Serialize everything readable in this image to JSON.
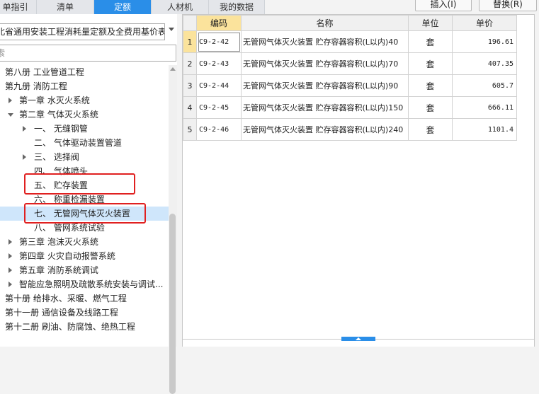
{
  "tabs": [
    {
      "label": "单指引",
      "active": false
    },
    {
      "label": "清单",
      "active": false
    },
    {
      "label": "定额",
      "active": true
    },
    {
      "label": "人材机",
      "active": false
    },
    {
      "label": "我的数据",
      "active": false
    }
  ],
  "actions": {
    "insert": "插入(I)",
    "replace": "替换(R)"
  },
  "library_select": {
    "value": "北省通用安装工程消耗量定额及全费用基价表"
  },
  "search": {
    "placeholder": "索"
  },
  "tree": [
    {
      "label": "第八册 工业管道工程",
      "level": 0,
      "expander": "none",
      "selected": false
    },
    {
      "label": "第九册 消防工程",
      "level": 0,
      "expander": "none",
      "selected": false
    },
    {
      "label": "第一章 水灭火系统",
      "level": 1,
      "expander": "collapsed",
      "selected": false
    },
    {
      "label": "第二章 气体灭火系统",
      "level": 1,
      "expander": "expanded",
      "selected": false
    },
    {
      "label": "一、 无缝钢管",
      "level": 2,
      "expander": "collapsed",
      "selected": false
    },
    {
      "label": "二、 气体驱动装置管道",
      "level": 2,
      "expander": "none",
      "selected": false
    },
    {
      "label": "三、 选择阀",
      "level": 2,
      "expander": "collapsed",
      "selected": false
    },
    {
      "label": "四、 气体喷头",
      "level": 2,
      "expander": "none",
      "selected": false
    },
    {
      "label": "五、 贮存装置",
      "level": 2,
      "expander": "none",
      "selected": false
    },
    {
      "label": "六、 称重检漏装置",
      "level": 2,
      "expander": "none",
      "selected": false
    },
    {
      "label": "七、 无管网气体灭火装置",
      "level": 2,
      "expander": "none",
      "selected": true
    },
    {
      "label": "八、 管网系统试验",
      "level": 2,
      "expander": "none",
      "selected": false
    },
    {
      "label": "第三章 泡沫灭火系统",
      "level": 1,
      "expander": "collapsed",
      "selected": false
    },
    {
      "label": "第四章 火灾自动报警系统",
      "level": 1,
      "expander": "collapsed",
      "selected": false
    },
    {
      "label": "第五章 消防系统调试",
      "level": 1,
      "expander": "collapsed",
      "selected": false
    },
    {
      "label": "智能应急照明及疏散系统安装与调试...",
      "level": 1,
      "expander": "collapsed",
      "selected": false
    },
    {
      "label": "第十册 给排水、采暖、燃气工程",
      "level": 0,
      "expander": "none",
      "selected": false
    },
    {
      "label": "第十一册 通信设备及线路工程",
      "level": 0,
      "expander": "none",
      "selected": false
    },
    {
      "label": "第十二册 刷油、防腐蚀、绝热工程",
      "level": 0,
      "expander": "none",
      "selected": false
    }
  ],
  "grid": {
    "columns": [
      "编码",
      "名称",
      "单位",
      "单价"
    ],
    "rows": [
      {
        "idx": "1",
        "code": "C9-2-42",
        "name": "无管网气体灭火装置 贮存容器容积(L以内)40",
        "unit": "套",
        "price": "196.61"
      },
      {
        "idx": "2",
        "code": "C9-2-43",
        "name": "无管网气体灭火装置 贮存容器容积(L以内)70",
        "unit": "套",
        "price": "407.35"
      },
      {
        "idx": "3",
        "code": "C9-2-44",
        "name": "无管网气体灭火装置 贮存容器容积(L以内)90",
        "unit": "套",
        "price": "605.7"
      },
      {
        "idx": "4",
        "code": "C9-2-45",
        "name": "无管网气体灭火装置 贮存容器容积(L以内)150",
        "unit": "套",
        "price": "666.11"
      },
      {
        "idx": "5",
        "code": "C9-2-46",
        "name": "无管网气体灭火装置 贮存容器容积(L以内)240",
        "unit": "套",
        "price": "1101.4"
      }
    ]
  },
  "colors": {
    "accent": "#2a8ee8",
    "highlight_box": "#e02020",
    "current_cell": "#fbe39c",
    "selected_row": "#cfe6fb"
  }
}
